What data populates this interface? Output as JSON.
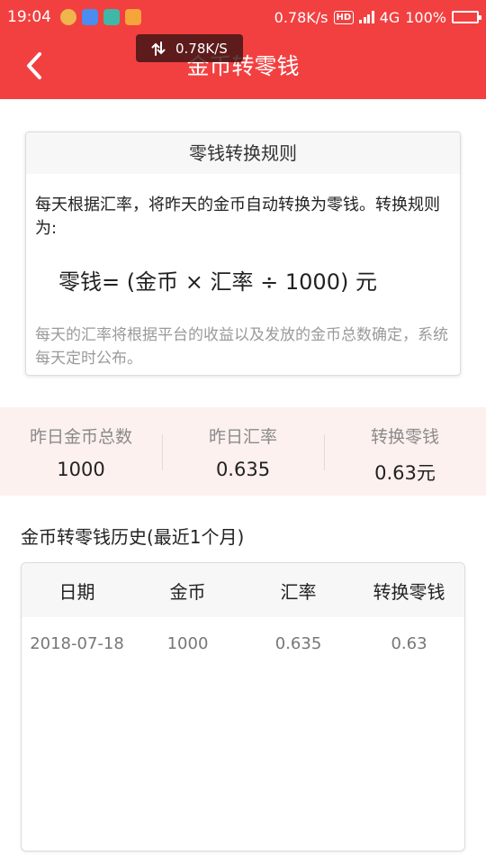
{
  "status_bar": {
    "time": "19:04",
    "net_speed": "0.78K/s",
    "hd": "HD",
    "network": "4G",
    "battery": "100%"
  },
  "speed_toast": {
    "text": "0.78K/S"
  },
  "header": {
    "title": "金币转零钱",
    "back_icon": "chevron-left-icon"
  },
  "rules": {
    "title": "零钱转换规则",
    "description": "每天根据汇率，将昨天的金币自动转换为零钱。转换规则为:",
    "formula": "零钱= (金币 × 汇率 ÷ 1000) 元",
    "note": "每天的汇率将根据平台的收益以及发放的金币总数确定，系统每天定时公布。"
  },
  "stats": [
    {
      "label": "昨日金币总数",
      "value": "1000"
    },
    {
      "label": "昨日汇率",
      "value": "0.635"
    },
    {
      "label": "转换零钱",
      "value": "0.63元"
    }
  ],
  "history": {
    "title": "金币转零钱历史(最近1个月)",
    "columns": [
      "日期",
      "金币",
      "汇率",
      "转换零钱"
    ],
    "rows": [
      [
        "2018-07-18",
        "1000",
        "0.635",
        "0.63"
      ]
    ]
  },
  "colors": {
    "header_bg": "#f24040",
    "stats_bg": "#fdf1ef",
    "text_primary": "#222222",
    "text_muted": "#9a9a9a"
  }
}
